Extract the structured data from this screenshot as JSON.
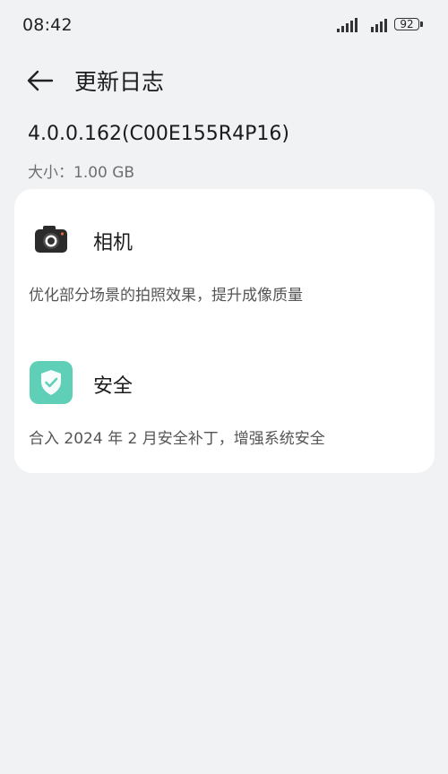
{
  "status_bar": {
    "time": "08:42",
    "battery": "92"
  },
  "header": {
    "title": "更新日志"
  },
  "update": {
    "version": "4.0.0.162(C00E155R4P16)",
    "size": "大小：1.00 GB"
  },
  "changes": [
    {
      "icon": "camera-icon",
      "title": "相机",
      "description": "优化部分场景的拍照效果，提升成像质量"
    },
    {
      "icon": "shield-icon",
      "title": "安全",
      "description": "合入 2024 年 2 月安全补丁，增强系统安全",
      "accent": "#5fcfb8"
    }
  ]
}
